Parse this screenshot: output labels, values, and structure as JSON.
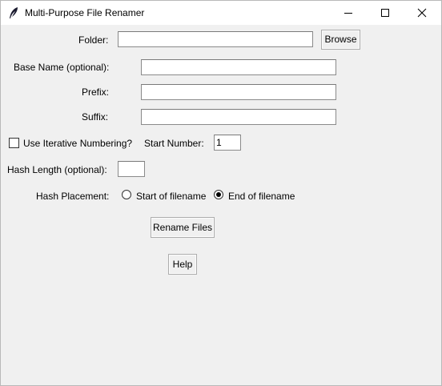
{
  "window": {
    "title": "Multi-Purpose File Renamer"
  },
  "form": {
    "folder_label": "Folder:",
    "folder_value": "",
    "browse_label": "Browse",
    "base_name_label": "Base Name (optional):",
    "base_name_value": "",
    "prefix_label": "Prefix:",
    "prefix_value": "",
    "suffix_label": "Suffix:",
    "suffix_value": "",
    "iterative_label": "Use Iterative Numbering?",
    "iterative_checked": false,
    "start_number_label": "Start Number:",
    "start_number_value": "1",
    "hash_length_label": "Hash Length (optional):",
    "hash_length_value": "",
    "hash_placement_label": "Hash Placement:",
    "placement_options": [
      "Start of filename",
      "End of filename"
    ],
    "placement_selected": "End of filename",
    "rename_label": "Rename Files",
    "help_label": "Help"
  }
}
